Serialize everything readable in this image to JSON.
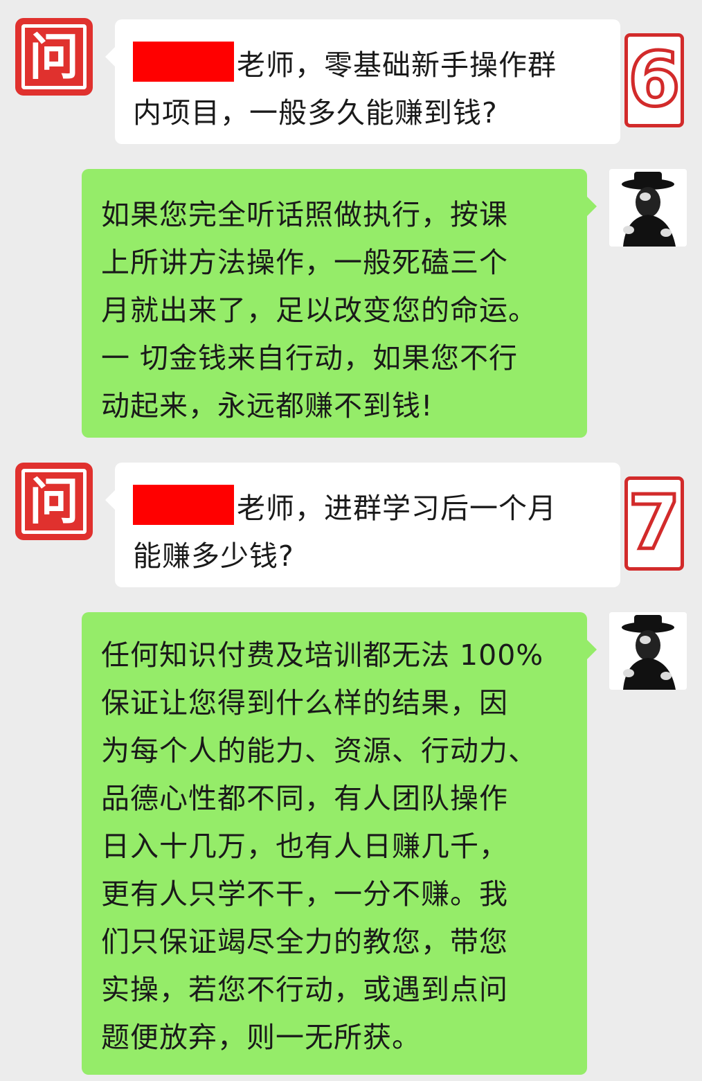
{
  "chat": {
    "q1": {
      "icon_char": "问",
      "text_line1": "老师，零基础新手操作群",
      "text_line2": "内项目，一般多久能赚到钱?",
      "badge": "6"
    },
    "a1": {
      "lines": [
        "如果您完全听话照做执行，按课",
        "上所讲方法操作，一般死磕三个",
        "月就出来了，足以改变您的命运。",
        "一 切金钱来自行动，如果您不行",
        "动起来，永远都赚不到钱!"
      ]
    },
    "q2": {
      "icon_char": "问",
      "text_line1": "老师，进群学习后一个月",
      "text_line2": "能赚多少钱?",
      "badge": "7"
    },
    "a2": {
      "lines": [
        "任何知识付费及培训都无法 100%",
        "保证让您得到什么样的结果，因",
        "为每个人的能力、资源、行动力、",
        "品德心性都不同，有人团队操作",
        "日入十几万，也有人日赚几千，",
        "更有人只学不干，一分不赚。我",
        "们只保证竭尽全力的教您，带您",
        "实操，若您不行动，或遇到点问",
        "题便放弃，则一无所获。"
      ]
    }
  },
  "colors": {
    "question_icon": "#e0312e",
    "answer_bubble": "#95ec69",
    "question_bubble": "#ffffff",
    "redaction": "#ff0000"
  }
}
